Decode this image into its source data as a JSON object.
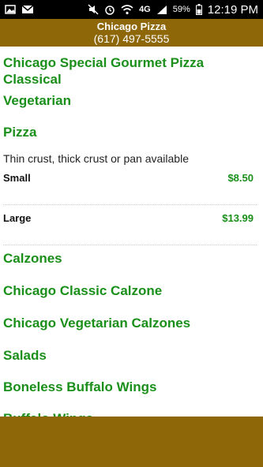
{
  "status_bar": {
    "network_label": "4G",
    "battery_percent": "59%",
    "time": "12:19 PM"
  },
  "header": {
    "title": "Chicago Pizza",
    "phone": "(617) 497-5555"
  },
  "menu": {
    "section_top_line1": "Chicago Special Gourmet Pizza",
    "section_top_line2": "Classical",
    "vegetarian": "Vegetarian",
    "pizza": "Pizza",
    "pizza_description": "Thin crust, thick crust or pan available",
    "prices": [
      {
        "size": "Small",
        "price": "$8.50"
      },
      {
        "size": "Large",
        "price": "$13.99"
      }
    ],
    "categories_below": [
      "Calzones",
      "Chicago Classic Calzone",
      "Chicago Vegetarian Calzones",
      "Salads",
      "Boneless Buffalo Wings",
      "Buffalo Wings"
    ]
  },
  "colors": {
    "brand_brown": "#8e6708",
    "accent_green": "#1a8f1a",
    "status_bar": "#000000"
  }
}
